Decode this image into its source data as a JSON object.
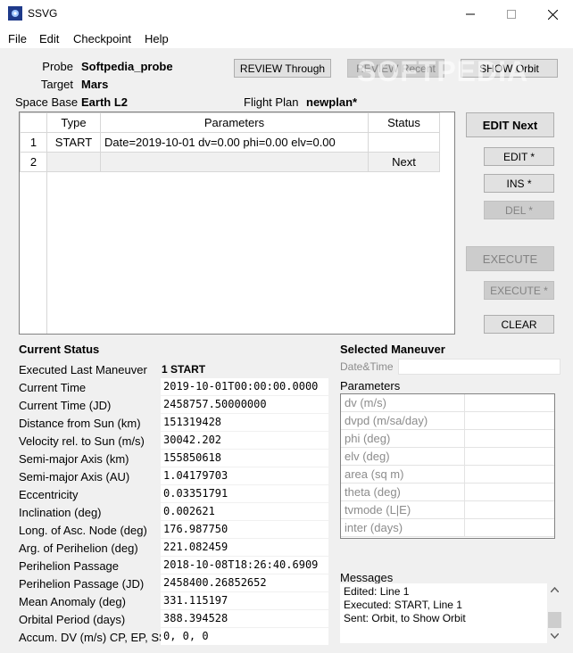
{
  "window": {
    "title": "SSVG"
  },
  "menu": [
    "File",
    "Edit",
    "Checkpoint",
    "Help"
  ],
  "probe": {
    "label": "Probe",
    "value": "Softpedia_probe"
  },
  "target": {
    "label": "Target",
    "value": "Mars"
  },
  "space_base": {
    "label": "Space Base",
    "value": "Earth L2"
  },
  "flight_plan": {
    "label": "Flight Plan",
    "value": "newplan*"
  },
  "top_buttons": {
    "review_through": "REVIEW Through",
    "review_recent": "REVIEW Recent",
    "show_orbit": "SHOW Orbit"
  },
  "watermark": "SOFTPEDIA",
  "plan_table": {
    "headers": [
      "Type",
      "Parameters",
      "Status"
    ],
    "rows": [
      {
        "num": "1",
        "type": "START",
        "params": "Date=2019-10-01 dv=0.00 phi=0.00 elv=0.00",
        "status": ""
      },
      {
        "num": "2",
        "type": "",
        "params": "",
        "status": "Next"
      }
    ]
  },
  "side_buttons": {
    "edit_next": "EDIT Next",
    "edit": "EDIT *",
    "ins": "INS *",
    "del": "DEL *",
    "execute": "EXECUTE",
    "execute_star": "EXECUTE *",
    "clear": "CLEAR"
  },
  "current_status": {
    "title": "Current Status",
    "executed_label": "Executed Last Maneuver",
    "executed_value": "1 START",
    "rows": [
      {
        "label": "Current Time",
        "value": "2019-10-01T00:00:00.0000"
      },
      {
        "label": "Current Time (JD)",
        "value": "2458757.50000000"
      },
      {
        "label": "Distance from Sun (km)",
        "value": "151319428"
      },
      {
        "label": "Velocity rel. to Sun (m/s)",
        "value": "30042.202"
      },
      {
        "label": "Semi-major Axis (km)",
        "value": "155850618"
      },
      {
        "label": "Semi-major Axis (AU)",
        "value": "1.04179703"
      },
      {
        "label": "Eccentricity",
        "value": "0.03351791"
      },
      {
        "label": "Inclination (deg)",
        "value": "0.002621"
      },
      {
        "label": "Long. of Asc. Node (deg)",
        "value": "176.987750"
      },
      {
        "label": "Arg. of Perihelion (deg)",
        "value": "221.082459"
      },
      {
        "label": "Perihelion Passage",
        "value": "2018-10-08T18:26:40.6909"
      },
      {
        "label": "Perihelion Passage (JD)",
        "value": "2458400.26852652"
      },
      {
        "label": "Mean Anomaly (deg)",
        "value": "331.115197"
      },
      {
        "label": "Orbital Period (days)",
        "value": "388.394528"
      },
      {
        "label": "Accum. DV (m/s) CP, EP, SS",
        "value": "0, 0, 0"
      }
    ]
  },
  "selected_maneuver": {
    "title": "Selected Maneuver",
    "datetime_label": "Date&Time",
    "params_title": "Parameters",
    "params": [
      "dv (m/s)",
      "dvpd (m/sa/day)",
      "phi (deg)",
      "elv (deg)",
      "area (sq m)",
      "theta (deg)",
      "tvmode (L|E)",
      "inter (days)"
    ]
  },
  "messages": {
    "title": "Messages",
    "lines": [
      "Edited: Line 1",
      "Executed: START, Line 1",
      "Sent: Orbit, to Show Orbit"
    ]
  }
}
